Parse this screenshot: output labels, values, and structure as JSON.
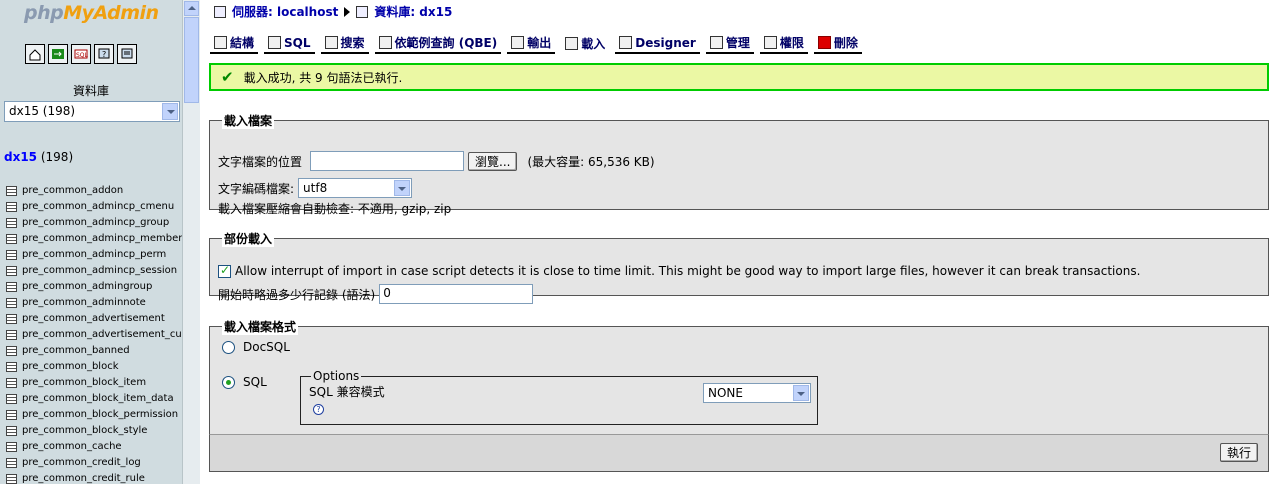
{
  "left": {
    "logo_a": "php",
    "logo_b": "MyAdmin",
    "icons": [
      "home-icon",
      "export-icon",
      "sql-icon",
      "query-icon",
      "docs-icon"
    ],
    "db_label": "資料庫",
    "db_select": "dx15 (198)",
    "db_name": "dx15",
    "db_count": "(198)",
    "tables": [
      "pre_common_addon",
      "pre_common_admincp_cmenu",
      "pre_common_admincp_group",
      "pre_common_admincp_member",
      "pre_common_admincp_perm",
      "pre_common_admincp_session",
      "pre_common_admingroup",
      "pre_common_adminnote",
      "pre_common_advertisement",
      "pre_common_advertisement_cust",
      "pre_common_banned",
      "pre_common_block",
      "pre_common_block_item",
      "pre_common_block_item_data",
      "pre_common_block_permission",
      "pre_common_block_style",
      "pre_common_cache",
      "pre_common_credit_log",
      "pre_common_credit_rule"
    ]
  },
  "breadcrumb": {
    "server": "伺服器: localhost",
    "database": "資料庫: dx15"
  },
  "tabs": [
    {
      "label": "結構"
    },
    {
      "label": "SQL"
    },
    {
      "label": "搜索"
    },
    {
      "label": "依範例查詢 (QBE)"
    },
    {
      "label": "輸出"
    },
    {
      "label": "載入"
    },
    {
      "label": "Designer"
    },
    {
      "label": "管理"
    },
    {
      "label": "權限"
    },
    {
      "label": "刪除"
    }
  ],
  "notice": "載入成功, 共 9 句語法已執行.",
  "import_file": {
    "legend": "載入檔案",
    "location_label": "文字檔案的位置",
    "browse": "瀏覽...",
    "max_size": "(最大容量: 65,536 KB)",
    "charset_label": "文字編碼檔案:",
    "charset_value": "utf8",
    "compression": "載入檔案壓縮會自動檢查: 不適用, gzip, zip"
  },
  "partial": {
    "legend": "部份載入",
    "allow_interrupt": "Allow interrupt of import in case script detects it is close to time limit. This might be good way to import large files, however it can break transactions.",
    "skip_label": "開始時略過多少行記錄 (語法)",
    "skip_value": "0"
  },
  "format": {
    "legend": "載入檔案格式",
    "docsql": "DocSQL",
    "sql": "SQL",
    "options_legend": "Options",
    "compat_label": "SQL 兼容模式",
    "compat_value": "NONE",
    "help": "?"
  },
  "go": "執行"
}
